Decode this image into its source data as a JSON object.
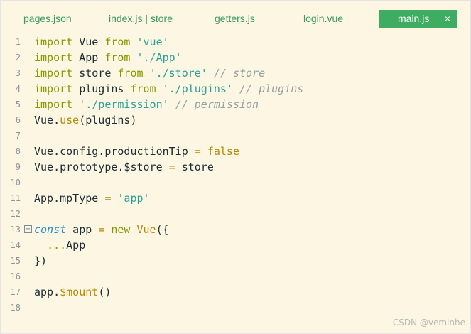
{
  "tabs": [
    {
      "label": "pages.json"
    },
    {
      "label": "index.js | store"
    },
    {
      "label": "getters.js"
    },
    {
      "label": "login.vue"
    }
  ],
  "active_tab": {
    "label": "main.js",
    "close_glyph": "×"
  },
  "colors": {
    "editor_background": "#fdf6e3",
    "active_tab": "#3fad61",
    "tab_text": "#3b9b5c",
    "keyword": "#859900",
    "string": "#2aa198",
    "comment": "#93a1a1",
    "function": "#b58900"
  },
  "editor": {
    "line_numbers": [
      "1",
      "2",
      "3",
      "4",
      "5",
      "6",
      "7",
      "8",
      "9",
      "10",
      "11",
      "12",
      "13",
      "14",
      "15",
      "16",
      "17",
      "18"
    ],
    "fold_glyph": "−",
    "lines": [
      [
        {
          "t": "kw",
          "v": "import"
        },
        {
          "t": "pl",
          "v": " Vue "
        },
        {
          "t": "kw",
          "v": "from"
        },
        {
          "t": "pl",
          "v": " "
        },
        {
          "t": "str",
          "v": "'vue'"
        }
      ],
      [
        {
          "t": "kw",
          "v": "import"
        },
        {
          "t": "pl",
          "v": " App "
        },
        {
          "t": "kw",
          "v": "from"
        },
        {
          "t": "pl",
          "v": " "
        },
        {
          "t": "str",
          "v": "'./App'"
        }
      ],
      [
        {
          "t": "kw",
          "v": "import"
        },
        {
          "t": "pl",
          "v": " store "
        },
        {
          "t": "kw",
          "v": "from"
        },
        {
          "t": "pl",
          "v": " "
        },
        {
          "t": "str",
          "v": "'./store'"
        },
        {
          "t": "pl",
          "v": " "
        },
        {
          "t": "cm",
          "v": "// store"
        }
      ],
      [
        {
          "t": "kw",
          "v": "import"
        },
        {
          "t": "pl",
          "v": " plugins "
        },
        {
          "t": "kw",
          "v": "from"
        },
        {
          "t": "pl",
          "v": " "
        },
        {
          "t": "str",
          "v": "'./plugins'"
        },
        {
          "t": "pl",
          "v": " "
        },
        {
          "t": "cm",
          "v": "// plugins"
        }
      ],
      [
        {
          "t": "kw",
          "v": "import"
        },
        {
          "t": "pl",
          "v": " "
        },
        {
          "t": "str",
          "v": "'./permission'"
        },
        {
          "t": "pl",
          "v": " "
        },
        {
          "t": "cm",
          "v": "// permission"
        }
      ],
      [
        {
          "t": "pl",
          "v": "Vue."
        },
        {
          "t": "fn",
          "v": "use"
        },
        {
          "t": "pl",
          "v": "(plugins)"
        }
      ],
      [],
      [
        {
          "t": "pl",
          "v": "Vue.config.productionTip "
        },
        {
          "t": "op",
          "v": "="
        },
        {
          "t": "pl",
          "v": " "
        },
        {
          "t": "fn",
          "v": "false"
        }
      ],
      [
        {
          "t": "pl",
          "v": "Vue.prototype.$store "
        },
        {
          "t": "op",
          "v": "="
        },
        {
          "t": "pl",
          "v": " store"
        }
      ],
      [],
      [
        {
          "t": "pl",
          "v": "App.mpType "
        },
        {
          "t": "op",
          "v": "="
        },
        {
          "t": "pl",
          "v": " "
        },
        {
          "t": "str",
          "v": "'app'"
        }
      ],
      [],
      [
        {
          "t": "kw-it",
          "v": "const"
        },
        {
          "t": "pl",
          "v": " app "
        },
        {
          "t": "op",
          "v": "="
        },
        {
          "t": "pl",
          "v": " "
        },
        {
          "t": "kw",
          "v": "new"
        },
        {
          "t": "pl",
          "v": " "
        },
        {
          "t": "fn",
          "v": "Vue"
        },
        {
          "t": "pl",
          "v": "({"
        }
      ],
      [
        {
          "t": "pl",
          "v": "  "
        },
        {
          "t": "op",
          "v": "..."
        },
        {
          "t": "pl",
          "v": "App"
        }
      ],
      [
        {
          "t": "pl",
          "v": "})"
        }
      ],
      [],
      [
        {
          "t": "pl",
          "v": "app."
        },
        {
          "t": "fn",
          "v": "$mount"
        },
        {
          "t": "pl",
          "v": "()"
        }
      ],
      []
    ]
  },
  "watermark": "CSDN @veminhe"
}
